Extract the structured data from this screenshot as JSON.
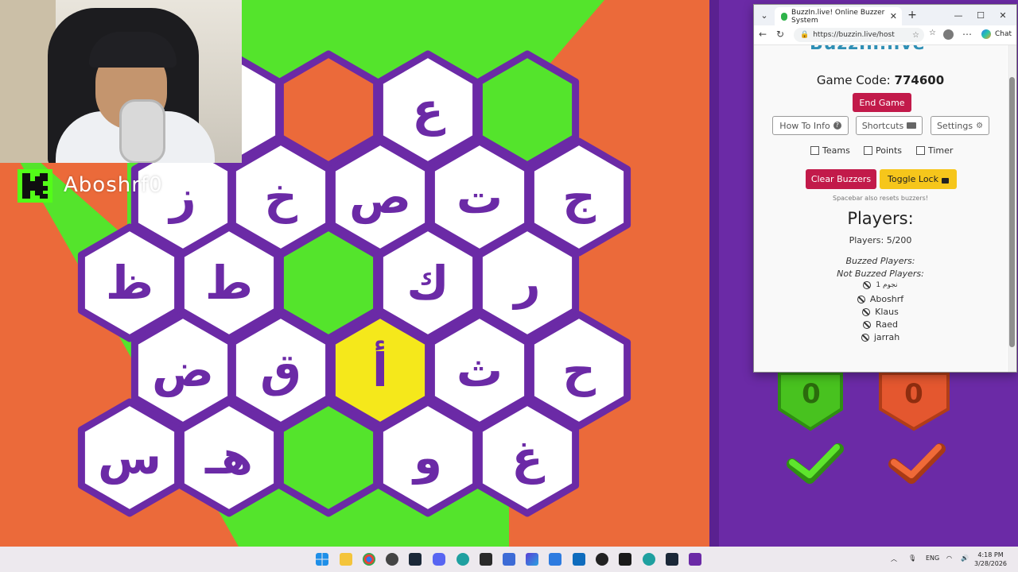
{
  "streamer": {
    "name": "Aboshrf0",
    "platform_color": "#53fc18"
  },
  "board": {
    "letters": [
      "ع",
      "ز",
      "خ",
      "ص",
      "ت",
      "ج",
      "ظ",
      "ط",
      "ك",
      "ر",
      "ض",
      "ق",
      "أ",
      "ث",
      "ح",
      "س",
      "هـ",
      "و",
      "غ"
    ],
    "colors": {
      "green": "#54e42c",
      "orange": "#eb6a3a",
      "purple": "#6b2aa6",
      "white": "#ffffff",
      "yellow": "#f5e81b"
    },
    "right_scores": {
      "team_green": "0",
      "team_orange": "0"
    }
  },
  "browser": {
    "tab_title": "BuzzIn.live! Online Buzzer System",
    "url": "https://buzzin.live/host",
    "chat_label": "Chat",
    "logo_partial": "BuzzIn.live"
  },
  "host": {
    "game_code_label": "Game Code:",
    "game_code": "774600",
    "end_game": "End Game",
    "how_to_info": "How To Info",
    "shortcuts": "Shortcuts",
    "settings": "Settings",
    "teams": "Teams",
    "points": "Points",
    "timer": "Timer",
    "clear_buzzers": "Clear Buzzers",
    "toggle_lock": "Toggle Lock",
    "spacebar_note": "Spacebar also resets buzzers!",
    "players_heading": "Players:",
    "players_count": "Players: 5/200",
    "buzzed_label": "Buzzed Players:",
    "not_buzzed_label": "Not Buzzed Players:",
    "not_buzzed": [
      "نجوم 1",
      "Aboshrf",
      "Klaus",
      "Raed",
      "jarrah"
    ]
  },
  "taskbar": {
    "lang": "ENG",
    "time": "4:18 PM",
    "date": "3/28/2026"
  }
}
